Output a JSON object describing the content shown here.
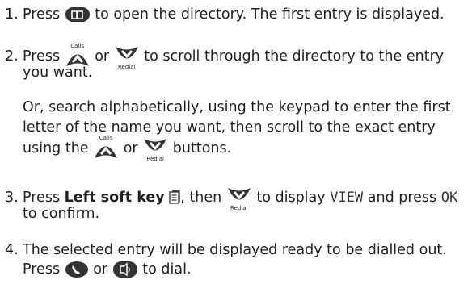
{
  "steps": [
    {
      "num": "1.",
      "l1a": "Press",
      "l1b": "to open the directory. The first entry is displayed."
    },
    {
      "num": "2.",
      "l1a": "Press",
      "l1b": "or",
      "l1c": "to scroll through the directory to the entry",
      "l2": "you want.",
      "p1": "Or, search alphabetically, using the keypad to enter the first",
      "p2": "letter of the name you want, then scroll to the exact entry",
      "p3a": "using the",
      "p3b": "or",
      "p3c": "buttons."
    },
    {
      "num": "3.",
      "l1a": "Press",
      "l1bold": "Left soft key",
      "l1b": ", then",
      "l1c": "to display",
      "lcd_view": "VIEW",
      "l1d": "and press",
      "lcd_ok": "OK",
      "l2": "to confirm."
    },
    {
      "num": "4.",
      "l1": "The selected entry will be displayed ready to be dialled out.",
      "l2a": "Press",
      "l2b": "or",
      "l2c": "to dial."
    }
  ],
  "icon_labels": {
    "calls": "Calls",
    "redial": "Redial"
  }
}
